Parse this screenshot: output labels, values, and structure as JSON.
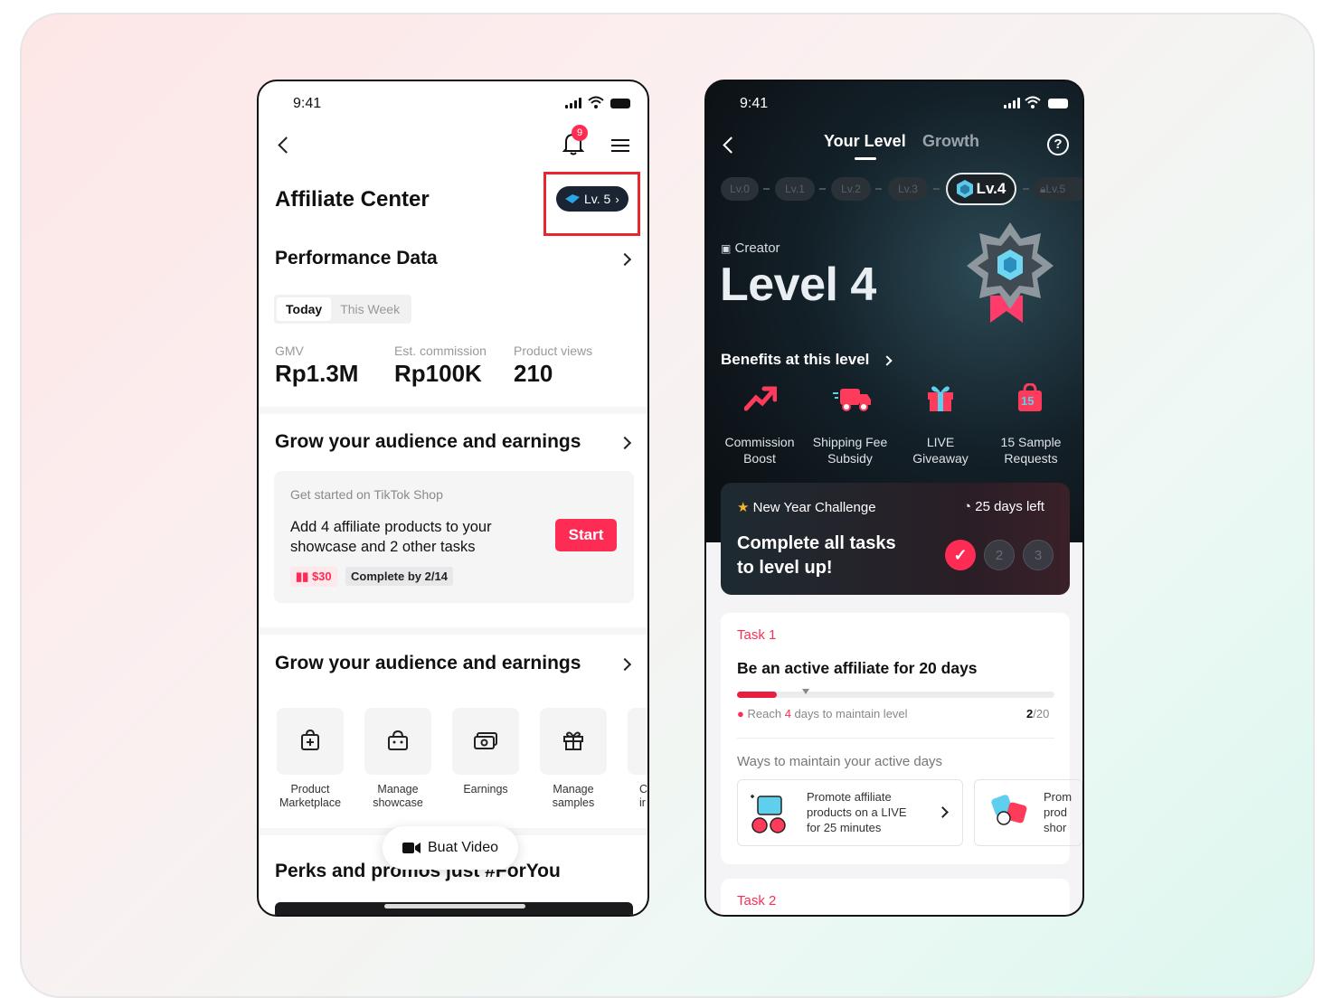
{
  "phone1": {
    "status_time": "9:41",
    "notification_count": "9",
    "title": "Affiliate Center",
    "level_badge": "Lv. 5",
    "performance": {
      "title": "Performance Data",
      "tabs": [
        "Today",
        "This Week"
      ],
      "metrics": [
        {
          "label": "GMV",
          "value": "Rp1.3M"
        },
        {
          "label": "Est. commission",
          "value": "Rp100K"
        },
        {
          "label": "Product views",
          "value": "210"
        }
      ]
    },
    "grow1": {
      "title": "Grow your audience and earnings",
      "card_subtitle": "Get started on TikTok Shop",
      "card_text_line1": "Add 4 affiliate products to your",
      "card_text_line2": "showcase and 2 other tasks",
      "start_label": "Start",
      "reward": "$30",
      "deadline": "Complete by 2/14"
    },
    "grow2": {
      "title": "Grow your audience and earnings",
      "tools": [
        {
          "line1": "Product",
          "line2": "Marketplace"
        },
        {
          "line1": "Manage",
          "line2": "showcase"
        },
        {
          "line1": "Earnings",
          "line2": ""
        },
        {
          "line1": "Manage",
          "line2": "samples"
        },
        {
          "line1": "C",
          "line2": "ir"
        }
      ]
    },
    "float_button": "Buat Video",
    "perks_title": "Perks and promos just #ForYou",
    "colors": {
      "accent": "#fe2c55",
      "highlight_box": "#e8262b"
    }
  },
  "phone2": {
    "status_time": "9:41",
    "tabs": [
      "Your Level",
      "Growth"
    ],
    "levels": [
      "Lv.0",
      "Lv.1",
      "Lv.2",
      "Lv.3",
      "Lv.4",
      "Lv.5"
    ],
    "role": "Creator",
    "level_title": "Level 4",
    "benefits_title": "Benefits at this level",
    "benefits": [
      {
        "line1": "Commission",
        "line2": "Boost",
        "icon": "trend-up-icon"
      },
      {
        "line1": "Shipping Fee",
        "line2": "Subsidy",
        "icon": "truck-icon"
      },
      {
        "line1": "LIVE",
        "line2": "Giveaway",
        "icon": "gift-icon"
      },
      {
        "line1": "15 Sample",
        "line2": "Requests",
        "icon": "bag-icon"
      }
    ],
    "bag_number": "15",
    "challenge": {
      "name": "New Year Challenge",
      "days_left": "25 days left",
      "headline_line1": "Complete all tasks",
      "headline_line2": "to level up!",
      "steps": [
        "✓",
        "2",
        "3"
      ]
    },
    "task1": {
      "label": "Task 1",
      "title": "Be an active affiliate for 20 days",
      "progress": 0.1,
      "reach_prefix": "Reach ",
      "reach_num": "4",
      "reach_suffix": " days to maintain level",
      "count_current": "2",
      "count_total": "/20",
      "ways_title": "Ways to maintain your active days",
      "way1_line1": "Promote affiliate",
      "way1_line2": "products on a LIVE",
      "way1_line3": "for 25 minutes",
      "way2_line1": "Prom",
      "way2_line2": "prod",
      "way2_line3": "shor"
    },
    "task2_label": "Task 2",
    "colors": {
      "accent": "#fe2c55",
      "dark": "#0d0f12"
    }
  }
}
